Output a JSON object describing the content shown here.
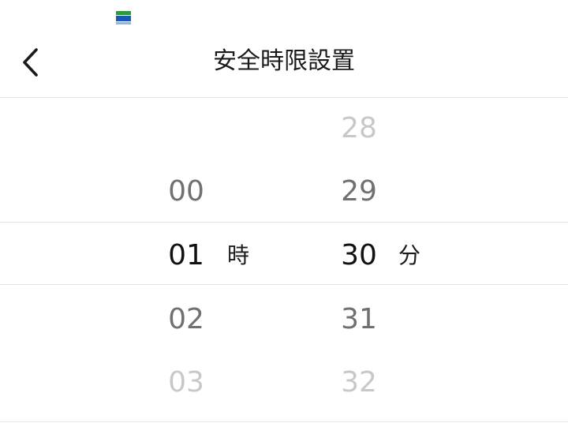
{
  "header": {
    "title": "安全時限設置"
  },
  "picker": {
    "hours": [
      "00",
      "01",
      "02",
      "03"
    ],
    "selected_hour": "01",
    "hour_unit": "時",
    "minutes": [
      "28",
      "29",
      "30",
      "31",
      "32"
    ],
    "selected_minute": "30",
    "minute_unit": "分"
  },
  "icons": {
    "back": "chevron-left-icon",
    "app": "app-logo-icon"
  },
  "colors": {
    "selected_text": "#111111",
    "adjacent_text": "#707070",
    "faded_text": "#c8c8c8",
    "divider": "#e3e3e3"
  }
}
